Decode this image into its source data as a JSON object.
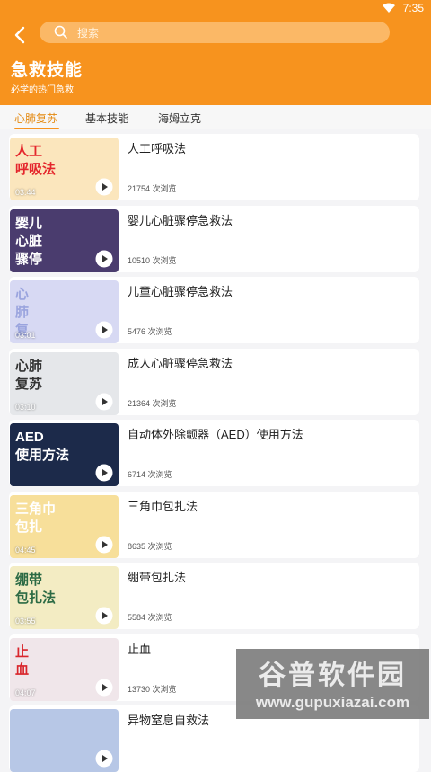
{
  "status": {
    "time": "7:35"
  },
  "search": {
    "placeholder": "搜索"
  },
  "header": {
    "title": "急救技能",
    "subtitle": "必学的热门急救"
  },
  "tabs": [
    {
      "label": "心肺复苏",
      "active": true
    },
    {
      "label": "基本技能",
      "active": false
    },
    {
      "label": "海姆立克",
      "active": false
    }
  ],
  "items": [
    {
      "title": "人工呼吸法",
      "views": "21754 次浏览",
      "duration": "03:44",
      "thumb_text": "人工\n呼吸法",
      "thumb_bg": "#fbe6bd"
    },
    {
      "title": "婴儿心脏骤停急救法",
      "views": "10510 次浏览",
      "duration": "",
      "thumb_text": "婴儿\n心脏\n骤停",
      "thumb_bg": "#4a3c6e"
    },
    {
      "title": "儿童心脏骤停急救法",
      "views": "5476 次浏览",
      "duration": "03:01",
      "thumb_text": "心\n肺\n复",
      "thumb_bg": "#d7d9f3"
    },
    {
      "title": "成人心脏骤停急救法",
      "views": "21364 次浏览",
      "duration": "03:10",
      "thumb_text": "心肺\n复苏",
      "thumb_bg": "#e5e7ea"
    },
    {
      "title": "自动体外除颤器（AED）使用方法",
      "views": "6714 次浏览",
      "duration": "",
      "thumb_text": "AED\n使用方法",
      "thumb_bg": "#1c2a4a"
    },
    {
      "title": "三角巾包扎法",
      "views": "8635 次浏览",
      "duration": "04:45",
      "thumb_text": "三角巾\n包扎",
      "thumb_bg": "#f7df9a"
    },
    {
      "title": "绷带包扎法",
      "views": "5584 次浏览",
      "duration": "03:55",
      "thumb_text": "绷带\n包扎法",
      "thumb_bg": "#f3ecc3"
    },
    {
      "title": "止血",
      "views": "13730 次浏览",
      "duration": "04:07",
      "thumb_text": "止\n血",
      "thumb_bg": "#f0e6ea"
    },
    {
      "title": "异物窒息自救法",
      "views": "",
      "duration": "",
      "thumb_text": "",
      "thumb_bg": "#b7c7e6"
    }
  ],
  "watermark": {
    "line1": "谷普软件园",
    "line2": "www.gupuxiazai.com"
  },
  "colors": {
    "accent": "#f7931e",
    "tab_active": "#e48a12"
  }
}
